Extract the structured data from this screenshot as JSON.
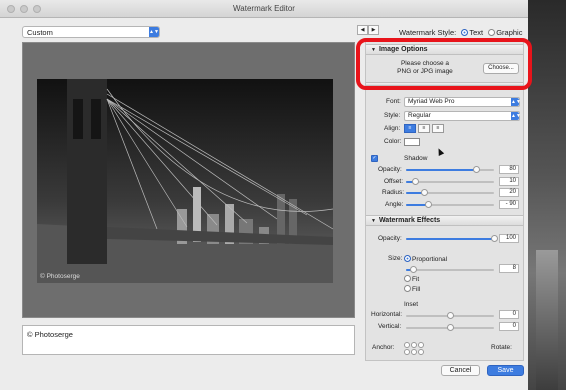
{
  "window": {
    "title": "Watermark Editor"
  },
  "preset": {
    "value": "Custom"
  },
  "watermark_style": {
    "label": "Watermark Style:",
    "options": [
      "Text",
      "Graphic"
    ],
    "selected": "Text"
  },
  "preview": {
    "photo_watermark": "© Photoserge"
  },
  "caption": {
    "text": "© Photoserge"
  },
  "image_options": {
    "header": "Image Options",
    "prompt_line1": "Please choose a",
    "prompt_line2": "PNG or JPG image",
    "choose_button": "Choose..."
  },
  "text_options": {
    "font_label": "Font:",
    "font_value": "Myriad Web Pro",
    "style_label": "Style:",
    "style_value": "Regular",
    "align_label": "Align:",
    "color_label": "Color:"
  },
  "shadow": {
    "label": "Shadow",
    "enabled": true,
    "opacity_label": "Opacity:",
    "opacity": "80",
    "offset_label": "Offset:",
    "offset": "10",
    "radius_label": "Radius:",
    "radius": "20",
    "angle_label": "Angle:",
    "angle": "- 90"
  },
  "effects": {
    "header": "Watermark Effects",
    "opacity_label": "Opacity:",
    "opacity": "100",
    "size_label": "Size:",
    "size_options": [
      "Proportional",
      "Fit",
      "Fill"
    ],
    "size_selected": "Proportional",
    "size_value": "8",
    "inset_label": "Inset",
    "horizontal_label": "Horizontal:",
    "horizontal": "0",
    "vertical_label": "Vertical:",
    "vertical": "0",
    "anchor_label": "Anchor:",
    "rotate_label": "Rotate:"
  },
  "footer": {
    "cancel": "Cancel",
    "save": "Save"
  },
  "slider_levels": {
    "shadow_opacity": 0.8,
    "shadow_offset": 0.1,
    "shadow_radius": 0.2,
    "shadow_angle": 0.25,
    "effects_opacity": 1.0,
    "effects_size": 0.08,
    "inset_horizontal": 0.5,
    "inset_vertical": 0.5
  },
  "colors": {
    "accent": "#3d7ce0",
    "highlight": "#e8141b"
  }
}
